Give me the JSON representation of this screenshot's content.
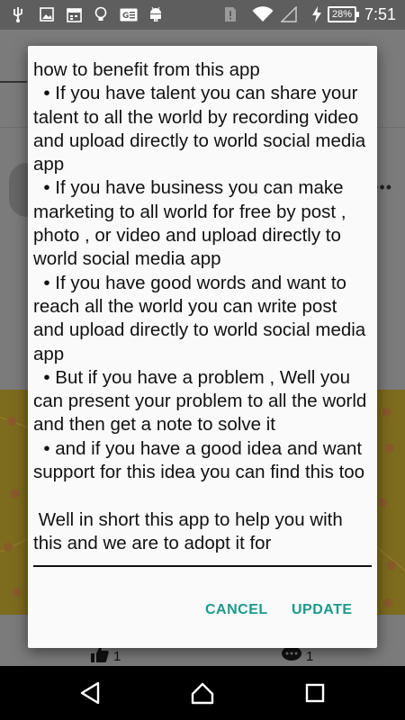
{
  "status_bar": {
    "battery": "28%",
    "time": "7:51",
    "icons": [
      "usb-icon",
      "image-icon",
      "calendar-icon",
      "lightbulb-icon",
      "card-icon",
      "android-icon",
      "sim-icon",
      "wifi-icon",
      "signal-icon",
      "charging-icon"
    ]
  },
  "background": {
    "likes_count": "1",
    "comments_count": "1"
  },
  "dialog": {
    "text": "how to benefit from this app\n  • If you have talent you can share your talent to all the world by recording video and upload directly to world social media app\n  • If you have business you can make marketing to all world for free by post , photo , or video and upload directly to world social media app\n  • If you have good words and want to reach all the world you can write post and upload directly to world social media app\n  • But if you have a problem , Well you can present your problem to all the world and then get a note to solve it\n  • and if you have a good idea and want support for this idea you can find this too\n\n Well in short this app to help you with this and we are to adopt it for",
    "cancel_label": "CANCEL",
    "update_label": "UPDATE",
    "accent_color": "#1a9a8a"
  },
  "nav_bar": {
    "buttons": [
      "back-icon",
      "home-icon",
      "recents-icon"
    ]
  }
}
